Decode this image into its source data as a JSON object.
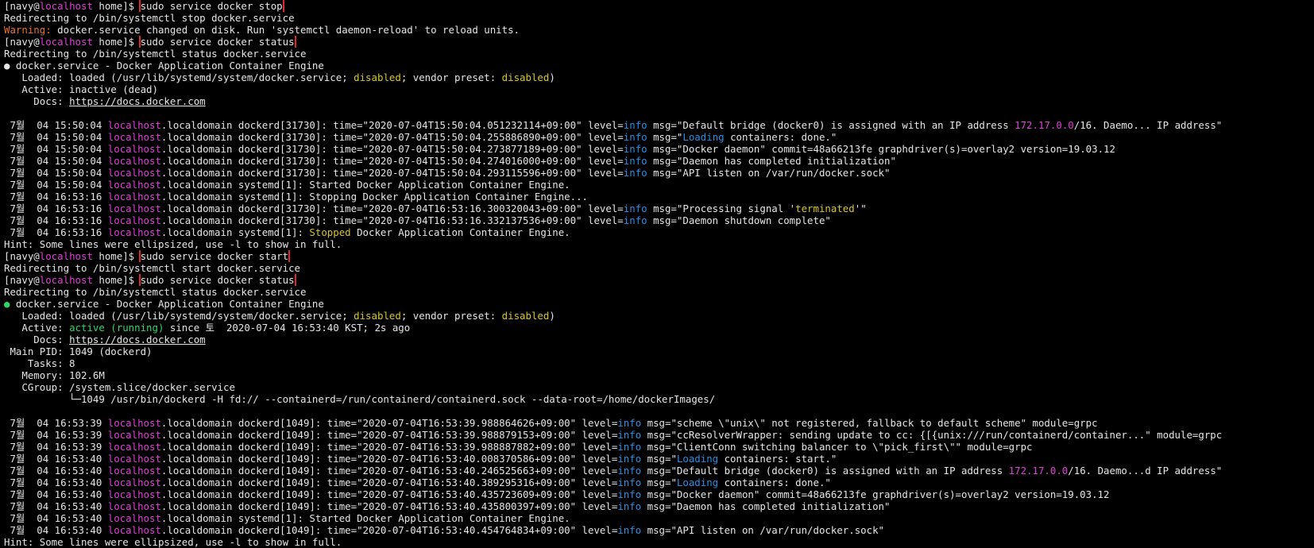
{
  "colors": {
    "background": "#000000",
    "text": "#e6e6e6",
    "host": "#e23fd9",
    "warning": "#e8722b",
    "disabled": "#d8c52d",
    "info": "#2a8fe6",
    "active": "#2fd66b",
    "highlight_box": "#e3262e"
  },
  "terminal": {
    "lines": [
      [
        {
          "t": "[navy@",
          "c": "w"
        },
        {
          "t": "localhost",
          "c": "magenta"
        },
        {
          "t": " home]$ ",
          "c": "w"
        },
        {
          "t": "sudo service docker stop",
          "c": "w",
          "box": true
        }
      ],
      [
        {
          "t": "Redirecting to /bin/systemctl stop docker.service",
          "c": "w"
        }
      ],
      [
        {
          "t": "Warning:",
          "c": "orange"
        },
        {
          "t": " docker.service changed on disk. Run 'systemctl daemon-reload' to reload units.",
          "c": "w"
        }
      ],
      [
        {
          "t": "[navy@",
          "c": "w"
        },
        {
          "t": "localhost",
          "c": "magenta"
        },
        {
          "t": " home]$ ",
          "c": "w"
        },
        {
          "t": "sudo service docker status",
          "c": "w",
          "box": true
        }
      ],
      [
        {
          "t": "Redirecting to /bin/systemctl status docker.service",
          "c": "w"
        }
      ],
      [
        {
          "t": "● docker.service - Docker Application Container Engine",
          "c": "w"
        }
      ],
      [
        {
          "t": "   Loaded: loaded (/usr/lib/systemd/system/docker.service; ",
          "c": "w"
        },
        {
          "t": "disabled",
          "c": "yellow"
        },
        {
          "t": "; vendor preset: ",
          "c": "w"
        },
        {
          "t": "disabled",
          "c": "yellow"
        },
        {
          "t": ")",
          "c": "w"
        }
      ],
      [
        {
          "t": "   Active: inactive (dead)",
          "c": "w"
        }
      ],
      [
        {
          "t": "     Docs: ",
          "c": "w"
        },
        {
          "t": "https://docs.docker.com",
          "c": "w",
          "u": true
        }
      ],
      [],
      [
        {
          "t": " 7월  04 15:50:04 ",
          "c": "w"
        },
        {
          "t": "localhost",
          "c": "magenta"
        },
        {
          "t": ".localdomain dockerd[31730]: time=\"2020-07-04T15:50:04.051232114+09:00\" level=",
          "c": "w"
        },
        {
          "t": "info",
          "c": "blue"
        },
        {
          "t": " msg=\"Default bridge (docker0) is assigned with an IP address ",
          "c": "w"
        },
        {
          "t": "172.17.0.0",
          "c": "magenta"
        },
        {
          "t": "/16. Daemo... IP address\"",
          "c": "w"
        }
      ],
      [
        {
          "t": " 7월  04 15:50:04 ",
          "c": "w"
        },
        {
          "t": "localhost",
          "c": "magenta"
        },
        {
          "t": ".localdomain dockerd[31730]: time=\"2020-07-04T15:50:04.255886890+09:00\" level=",
          "c": "w"
        },
        {
          "t": "info",
          "c": "blue"
        },
        {
          "t": " msg=\"",
          "c": "w"
        },
        {
          "t": "Loading",
          "c": "blue"
        },
        {
          "t": " containers: done.\"",
          "c": "w"
        }
      ],
      [
        {
          "t": " 7월  04 15:50:04 ",
          "c": "w"
        },
        {
          "t": "localhost",
          "c": "magenta"
        },
        {
          "t": ".localdomain dockerd[31730]: time=\"2020-07-04T15:50:04.273877189+09:00\" level=",
          "c": "w"
        },
        {
          "t": "info",
          "c": "blue"
        },
        {
          "t": " msg=\"Docker daemon\" commit=48a66213fe graphdriver(s)=overlay2 version=19.03.12",
          "c": "w"
        }
      ],
      [
        {
          "t": " 7월  04 15:50:04 ",
          "c": "w"
        },
        {
          "t": "localhost",
          "c": "magenta"
        },
        {
          "t": ".localdomain dockerd[31730]: time=\"2020-07-04T15:50:04.274016000+09:00\" level=",
          "c": "w"
        },
        {
          "t": "info",
          "c": "blue"
        },
        {
          "t": " msg=\"Daemon has completed initialization\"",
          "c": "w"
        }
      ],
      [
        {
          "t": " 7월  04 15:50:04 ",
          "c": "w"
        },
        {
          "t": "localhost",
          "c": "magenta"
        },
        {
          "t": ".localdomain dockerd[31730]: time=\"2020-07-04T15:50:04.293115596+09:00\" level=",
          "c": "w"
        },
        {
          "t": "info",
          "c": "blue"
        },
        {
          "t": " msg=\"API listen on /var/run/docker.sock\"",
          "c": "w"
        }
      ],
      [
        {
          "t": " 7월  04 15:50:04 ",
          "c": "w"
        },
        {
          "t": "localhost",
          "c": "magenta"
        },
        {
          "t": ".localdomain systemd[1]: Started Docker Application Container Engine.",
          "c": "w"
        }
      ],
      [
        {
          "t": " 7월  04 16:53:16 ",
          "c": "w"
        },
        {
          "t": "localhost",
          "c": "magenta"
        },
        {
          "t": ".localdomain systemd[1]: Stopping Docker Application Container Engine...",
          "c": "w"
        }
      ],
      [
        {
          "t": " 7월  04 16:53:16 ",
          "c": "w"
        },
        {
          "t": "localhost",
          "c": "magenta"
        },
        {
          "t": ".localdomain dockerd[31730]: time=\"2020-07-04T16:53:16.300320043+09:00\" level=",
          "c": "w"
        },
        {
          "t": "info",
          "c": "blue"
        },
        {
          "t": " msg=\"Processing signal '",
          "c": "w"
        },
        {
          "t": "terminated",
          "c": "yellow"
        },
        {
          "t": "'\"",
          "c": "w"
        }
      ],
      [
        {
          "t": " 7월  04 16:53:16 ",
          "c": "w"
        },
        {
          "t": "localhost",
          "c": "magenta"
        },
        {
          "t": ".localdomain dockerd[31730]: time=\"2020-07-04T16:53:16.332137536+09:00\" level=",
          "c": "w"
        },
        {
          "t": "info",
          "c": "blue"
        },
        {
          "t": " msg=\"Daemon shutdown complete\"",
          "c": "w"
        }
      ],
      [
        {
          "t": " 7월  04 16:53:16 ",
          "c": "w"
        },
        {
          "t": "localhost",
          "c": "magenta"
        },
        {
          "t": ".localdomain systemd[1]: ",
          "c": "w"
        },
        {
          "t": "Stopped",
          "c": "yellow"
        },
        {
          "t": " Docker Application Container Engine.",
          "c": "w"
        }
      ],
      [
        {
          "t": "Hint: Some lines were ellipsized, use -l to show in full.",
          "c": "w"
        }
      ],
      [
        {
          "t": "[navy@",
          "c": "w"
        },
        {
          "t": "localhost",
          "c": "magenta"
        },
        {
          "t": " home]$ ",
          "c": "w"
        },
        {
          "t": "sudo service docker start",
          "c": "w",
          "box": true
        }
      ],
      [
        {
          "t": "Redirecting to /bin/systemctl start docker.service",
          "c": "w"
        }
      ],
      [
        {
          "t": "[navy@",
          "c": "w"
        },
        {
          "t": "localhost",
          "c": "magenta"
        },
        {
          "t": " home]$ ",
          "c": "w"
        },
        {
          "t": "sudo service docker status",
          "c": "w",
          "box": true
        }
      ],
      [
        {
          "t": "Redirecting to /bin/systemctl status docker.service",
          "c": "w"
        }
      ],
      [
        {
          "t": "●",
          "c": "green"
        },
        {
          "t": " docker.service - Docker Application Container Engine",
          "c": "w"
        }
      ],
      [
        {
          "t": "   Loaded: loaded (/usr/lib/systemd/system/docker.service; ",
          "c": "w"
        },
        {
          "t": "disabled",
          "c": "yellow"
        },
        {
          "t": "; vendor preset: ",
          "c": "w"
        },
        {
          "t": "disabled",
          "c": "yellow"
        },
        {
          "t": ")",
          "c": "w"
        }
      ],
      [
        {
          "t": "   Active: ",
          "c": "w"
        },
        {
          "t": "active (running)",
          "c": "green"
        },
        {
          "t": " since 토  2020-07-04 16:53:40 KST; 2s ago",
          "c": "w"
        }
      ],
      [
        {
          "t": "     Docs: ",
          "c": "w"
        },
        {
          "t": "https://docs.docker.com",
          "c": "w",
          "u": true
        }
      ],
      [
        {
          "t": " Main PID: 1049 (dockerd)",
          "c": "w"
        }
      ],
      [
        {
          "t": "    Tasks: 8",
          "c": "w"
        }
      ],
      [
        {
          "t": "   Memory: 102.6M",
          "c": "w"
        }
      ],
      [
        {
          "t": "   CGroup: /system.slice/docker.service",
          "c": "w"
        }
      ],
      [
        {
          "t": "           └─1049 /usr/bin/dockerd -H fd:// --containerd=/run/containerd/containerd.sock --data-root=/home/dockerImages/",
          "c": "w"
        }
      ],
      [],
      [
        {
          "t": " 7월  04 16:53:39 ",
          "c": "w"
        },
        {
          "t": "localhost",
          "c": "magenta"
        },
        {
          "t": ".localdomain dockerd[1049]: time=\"2020-07-04T16:53:39.988864626+09:00\" level=",
          "c": "w"
        },
        {
          "t": "info",
          "c": "blue"
        },
        {
          "t": " msg=\"scheme \\\"unix\\\" not registered, fallback to default scheme\" module=grpc",
          "c": "w"
        }
      ],
      [
        {
          "t": " 7월  04 16:53:39 ",
          "c": "w"
        },
        {
          "t": "localhost",
          "c": "magenta"
        },
        {
          "t": ".localdomain dockerd[1049]: time=\"2020-07-04T16:53:39.988879153+09:00\" level=",
          "c": "w"
        },
        {
          "t": "info",
          "c": "blue"
        },
        {
          "t": " msg=\"ccResolverWrapper: sending update to cc: {[{unix:///run/containerd/container...\" module=grpc",
          "c": "w"
        }
      ],
      [
        {
          "t": " 7월  04 16:53:39 ",
          "c": "w"
        },
        {
          "t": "localhost",
          "c": "magenta"
        },
        {
          "t": ".localdomain dockerd[1049]: time=\"2020-07-04T16:53:39.988887882+09:00\" level=",
          "c": "w"
        },
        {
          "t": "info",
          "c": "blue"
        },
        {
          "t": " msg=\"ClientConn switching balancer to \\\"pick_first\\\"\" module=grpc",
          "c": "w"
        }
      ],
      [
        {
          "t": " 7월  04 16:53:40 ",
          "c": "w"
        },
        {
          "t": "localhost",
          "c": "magenta"
        },
        {
          "t": ".localdomain dockerd[1049]: time=\"2020-07-04T16:53:40.008370586+09:00\" level=",
          "c": "w"
        },
        {
          "t": "info",
          "c": "blue"
        },
        {
          "t": " msg=\"",
          "c": "w"
        },
        {
          "t": "Loading",
          "c": "blue"
        },
        {
          "t": " containers: start.\"",
          "c": "w"
        }
      ],
      [
        {
          "t": " 7월  04 16:53:40 ",
          "c": "w"
        },
        {
          "t": "localhost",
          "c": "magenta"
        },
        {
          "t": ".localdomain dockerd[1049]: time=\"2020-07-04T16:53:40.246525663+09:00\" level=",
          "c": "w"
        },
        {
          "t": "info",
          "c": "blue"
        },
        {
          "t": " msg=\"Default bridge (docker0) is assigned with an IP address ",
          "c": "w"
        },
        {
          "t": "172.17.0.0",
          "c": "magenta"
        },
        {
          "t": "/16. Daemo...d IP address\"",
          "c": "w"
        }
      ],
      [
        {
          "t": " 7월  04 16:53:40 ",
          "c": "w"
        },
        {
          "t": "localhost",
          "c": "magenta"
        },
        {
          "t": ".localdomain dockerd[1049]: time=\"2020-07-04T16:53:40.389295316+09:00\" level=",
          "c": "w"
        },
        {
          "t": "info",
          "c": "blue"
        },
        {
          "t": " msg=\"",
          "c": "w"
        },
        {
          "t": "Loading",
          "c": "blue"
        },
        {
          "t": " containers: done.\"",
          "c": "w"
        }
      ],
      [
        {
          "t": " 7월  04 16:53:40 ",
          "c": "w"
        },
        {
          "t": "localhost",
          "c": "magenta"
        },
        {
          "t": ".localdomain dockerd[1049]: time=\"2020-07-04T16:53:40.435723609+09:00\" level=",
          "c": "w"
        },
        {
          "t": "info",
          "c": "blue"
        },
        {
          "t": " msg=\"Docker daemon\" commit=48a66213fe graphdriver(s)=overlay2 version=19.03.12",
          "c": "w"
        }
      ],
      [
        {
          "t": " 7월  04 16:53:40 ",
          "c": "w"
        },
        {
          "t": "localhost",
          "c": "magenta"
        },
        {
          "t": ".localdomain dockerd[1049]: time=\"2020-07-04T16:53:40.435800397+09:00\" level=",
          "c": "w"
        },
        {
          "t": "info",
          "c": "blue"
        },
        {
          "t": " msg=\"Daemon has completed initialization\"",
          "c": "w"
        }
      ],
      [
        {
          "t": " 7월  04 16:53:40 ",
          "c": "w"
        },
        {
          "t": "localhost",
          "c": "magenta"
        },
        {
          "t": ".localdomain systemd[1]: Started Docker Application Container Engine.",
          "c": "w"
        }
      ],
      [
        {
          "t": " 7월  04 16:53:40 ",
          "c": "w"
        },
        {
          "t": "localhost",
          "c": "magenta"
        },
        {
          "t": ".localdomain dockerd[1049]: time=\"2020-07-04T16:53:40.454764834+09:00\" level=",
          "c": "w"
        },
        {
          "t": "info",
          "c": "blue"
        },
        {
          "t": " msg=\"API listen on /var/run/docker.sock\"",
          "c": "w"
        }
      ],
      [
        {
          "t": "Hint: Some lines were ellipsized, use -l to show in full.",
          "c": "w"
        }
      ]
    ]
  }
}
